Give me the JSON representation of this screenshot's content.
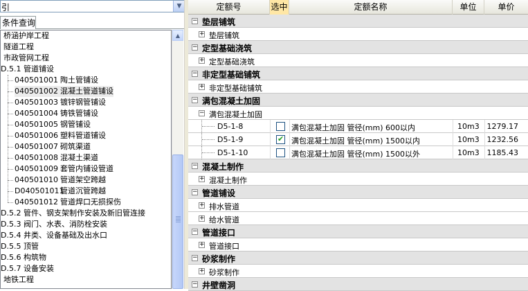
{
  "combo": {
    "value": "引",
    "arrow": "▼"
  },
  "tab": {
    "label": "条件查询"
  },
  "tree": [
    {
      "code": "",
      "label": "桥涵护岸工程",
      "indent": 4,
      "selected": false
    },
    {
      "code": "",
      "label": "隧道工程",
      "indent": 4,
      "selected": false
    },
    {
      "code": "",
      "label": "市政管网工程",
      "indent": 4,
      "selected": false
    },
    {
      "code": "",
      "label": "D.5.1 管道铺设",
      "indent": 0,
      "selected": false
    },
    {
      "code": "040501001",
      "label": "陶土管铺设",
      "indent": 20,
      "selected": false
    },
    {
      "code": "040501002",
      "label": "混凝土管道铺设",
      "indent": 20,
      "selected": true
    },
    {
      "code": "040501003",
      "label": "镀锌钢管铺设",
      "indent": 20,
      "selected": false
    },
    {
      "code": "040501004",
      "label": "铸铁管铺设",
      "indent": 20,
      "selected": false
    },
    {
      "code": "040501005",
      "label": "钢管铺设",
      "indent": 20,
      "selected": false
    },
    {
      "code": "040501006",
      "label": "塑料管道铺设",
      "indent": 20,
      "selected": false
    },
    {
      "code": "040501007",
      "label": "砌筑渠道",
      "indent": 20,
      "selected": false
    },
    {
      "code": "040501008",
      "label": "混凝土渠道",
      "indent": 20,
      "selected": false
    },
    {
      "code": "040501009",
      "label": "套管内铺设管道",
      "indent": 20,
      "selected": false
    },
    {
      "code": "040501010",
      "label": "管道架空跨越",
      "indent": 20,
      "selected": false
    },
    {
      "code": "D040501011",
      "label": "管道沉管跨越",
      "indent": 20,
      "selected": false
    },
    {
      "code": "040501012",
      "label": "管道焊口无损探伤",
      "indent": 20,
      "selected": false
    },
    {
      "code": "",
      "label": "D.5.2 管件、钢支架制作安装及新旧管连接",
      "indent": 0,
      "selected": false
    },
    {
      "code": "",
      "label": "D.5.3 阀门、水表、消防栓安装",
      "indent": 0,
      "selected": false
    },
    {
      "code": "",
      "label": "D.5.4 井类、设备基础及出水口",
      "indent": 0,
      "selected": false
    },
    {
      "code": "",
      "label": "D.5.5 顶管",
      "indent": 0,
      "selected": false
    },
    {
      "code": "",
      "label": "D.5.6 构筑物",
      "indent": 0,
      "selected": false
    },
    {
      "code": "",
      "label": "D.5.7 设备安装",
      "indent": 0,
      "selected": false
    },
    {
      "code": "",
      "label": "地铁工程",
      "indent": 4,
      "selected": false
    }
  ],
  "scroll": {
    "up": "▲",
    "down": "▼"
  },
  "grid": {
    "headers": {
      "code": "定额号",
      "select": "选中",
      "name": "定额名称",
      "unit": "单位",
      "price": "单价"
    },
    "rows": [
      {
        "type": "group",
        "sign": "−",
        "label": "垫层铺筑"
      },
      {
        "type": "sub",
        "sign": "+",
        "label": "垫层铺筑"
      },
      {
        "type": "group",
        "sign": "−",
        "label": "定型基础浇筑"
      },
      {
        "type": "sub",
        "sign": "+",
        "label": "定型基础浇筑"
      },
      {
        "type": "group",
        "sign": "−",
        "label": "非定型基础铺筑"
      },
      {
        "type": "sub",
        "sign": "+",
        "label": "非定型基础铺筑"
      },
      {
        "type": "group",
        "sign": "−",
        "label": "满包混凝土加固"
      },
      {
        "type": "sub",
        "sign": "−",
        "label": "满包混凝土加固"
      },
      {
        "type": "item",
        "code": "D5-1-8",
        "checked": false,
        "name": "满包混凝土加固 管径(mm) 600以内",
        "unit": "10m3",
        "price": "1279.17"
      },
      {
        "type": "item",
        "code": "D5-1-9",
        "checked": true,
        "name": "满包混凝土加固 管径(mm) 1500以内",
        "unit": "10m3",
        "price": "1232.56"
      },
      {
        "type": "item",
        "code": "D5-1-10",
        "checked": false,
        "name": "满包混凝土加固 管径(mm) 1500以外",
        "unit": "10m3",
        "price": "1185.43"
      },
      {
        "type": "group",
        "sign": "−",
        "label": "混凝土制作"
      },
      {
        "type": "sub",
        "sign": "+",
        "label": "混凝土制作"
      },
      {
        "type": "group",
        "sign": "−",
        "label": "管道铺设"
      },
      {
        "type": "sub",
        "sign": "+",
        "label": "排水管道"
      },
      {
        "type": "sub",
        "sign": "+",
        "label": "给水管道"
      },
      {
        "type": "group",
        "sign": "−",
        "label": "管道接口"
      },
      {
        "type": "sub",
        "sign": "+",
        "label": "管道接口"
      },
      {
        "type": "group",
        "sign": "−",
        "label": "砂浆制作"
      },
      {
        "type": "sub",
        "sign": "+",
        "label": "砂浆制作"
      },
      {
        "type": "group",
        "sign": "−",
        "label": "井壁凿洞"
      }
    ]
  }
}
